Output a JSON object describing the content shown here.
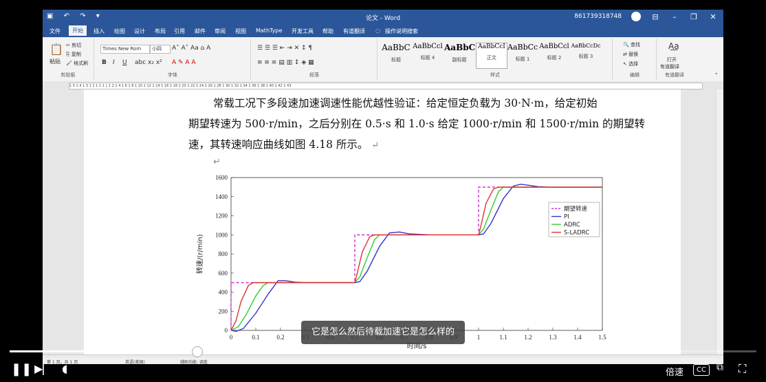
{
  "window": {
    "title": "论文 - Word",
    "account": "861739318748"
  },
  "menu": {
    "tabs": [
      "文件",
      "开始",
      "插入",
      "绘图",
      "设计",
      "布局",
      "引用",
      "邮件",
      "审阅",
      "视图",
      "MathType",
      "开发工具",
      "帮助",
      "有道翻译"
    ],
    "active_tab": "开始",
    "tell_me": "操作说明搜索"
  },
  "ribbon": {
    "clipboard": {
      "paste": "粘贴",
      "cut": "剪切",
      "copy": "复制",
      "format_painter": "格式刷",
      "label": "剪贴板"
    },
    "font": {
      "name": "Times New Rom",
      "size": "小四",
      "label": "字体"
    },
    "paragraph": {
      "label": "段落"
    },
    "styles": {
      "items": [
        {
          "sample": "AaBbC",
          "name": "标题"
        },
        {
          "sample": "AaBbCcl",
          "name": "标题 4"
        },
        {
          "sample": "AaBbC",
          "name": "副标题"
        },
        {
          "sample": "AaBbCcI",
          "name": "正文"
        },
        {
          "sample": "AaBbCc",
          "name": "标题 1"
        },
        {
          "sample": "AaBbCcl",
          "name": "标题 2"
        },
        {
          "sample": "AaBbCcDc",
          "name": "标题 3"
        }
      ],
      "label": "样式"
    },
    "editing": {
      "find": "查找",
      "replace": "替换",
      "select": "选择",
      "label": "编辑"
    },
    "translate": {
      "open": "打开",
      "youdao": "有道翻译",
      "label": "有道翻译"
    }
  },
  "document": {
    "line1": "常载工况下多段速加速调速性能优越性验证：给定恒定负载为 30·N·m，给定初始",
    "line2": "期望转速为 500·r/min，之后分别在 0.5·s 和 1.0·s 给定 1000·r/min 和 1500·r/min 的期望转",
    "line3": "速，其转速响应曲线如图 4.18 所示。"
  },
  "chart_data": {
    "type": "line",
    "xlabel": "时间/s",
    "ylabel": "转速/(r/min)",
    "xlim": [
      0,
      1.5
    ],
    "ylim": [
      0,
      1600
    ],
    "xticks": [
      0,
      0.1,
      0.2,
      0.3,
      0.4,
      0.5,
      0.6,
      0.7,
      0.8,
      0.9,
      1,
      1.1,
      1.2,
      1.3,
      1.4,
      1.5
    ],
    "yticks": [
      0,
      200,
      400,
      600,
      800,
      1000,
      1200,
      1400,
      1600
    ],
    "legend_position": "top-right",
    "grid": false,
    "series": [
      {
        "name": "期望转速",
        "color": "#cc33cc",
        "style": "dashed",
        "x": [
          0,
          0,
          0.5,
          0.5,
          1.0,
          1.0,
          1.5
        ],
        "y": [
          0,
          500,
          500,
          1000,
          1000,
          1500,
          1500
        ]
      },
      {
        "name": "PI",
        "color": "#3333cc",
        "style": "solid",
        "x": [
          0,
          0.02,
          0.05,
          0.1,
          0.15,
          0.19,
          0.22,
          0.26,
          0.3,
          0.5,
          0.52,
          0.55,
          0.6,
          0.64,
          0.68,
          0.72,
          0.8,
          1.0,
          1.02,
          1.05,
          1.1,
          1.14,
          1.17,
          1.2,
          1.24,
          1.3,
          1.5
        ],
        "y": [
          0,
          -10,
          20,
          180,
          380,
          520,
          520,
          505,
          500,
          500,
          510,
          620,
          880,
          1020,
          1030,
          1010,
          1000,
          1000,
          1010,
          1120,
          1380,
          1510,
          1530,
          1520,
          1505,
          1500,
          1500
        ]
      },
      {
        "name": "ADRC",
        "color": "#33cc33",
        "style": "solid",
        "x": [
          0,
          0.03,
          0.06,
          0.1,
          0.13,
          0.15,
          0.18,
          0.5,
          0.52,
          0.55,
          0.58,
          0.6,
          0.62,
          0.66,
          1.0,
          1.02,
          1.05,
          1.08,
          1.1,
          1.12,
          1.16,
          1.5
        ],
        "y": [
          0,
          40,
          160,
          360,
          470,
          500,
          500,
          500,
          560,
          760,
          950,
          1000,
          1000,
          1000,
          1000,
          1060,
          1260,
          1450,
          1500,
          1500,
          1500,
          1500
        ]
      },
      {
        "name": "S-LADRC",
        "color": "#dd3333",
        "style": "solid",
        "x": [
          0,
          0.02,
          0.04,
          0.07,
          0.09,
          0.12,
          0.5,
          0.51,
          0.53,
          0.56,
          0.58,
          0.62,
          1.0,
          1.01,
          1.03,
          1.06,
          1.08,
          1.12,
          1.5
        ],
        "y": [
          0,
          100,
          300,
          470,
          500,
          500,
          500,
          600,
          820,
          980,
          1000,
          1000,
          1000,
          1100,
          1330,
          1480,
          1500,
          1500,
          1500
        ]
      }
    ]
  },
  "player": {
    "caption": "它是怎么然后待载加速它是怎么样的",
    "speed_label": "倍速",
    "cc_label": "CC",
    "progress_fraction": 0.25
  },
  "statusbar": {
    "page": "第 1 页，共 1 页",
    "language": "英语(美国)",
    "accessibility": "辅助功能: 调查"
  }
}
